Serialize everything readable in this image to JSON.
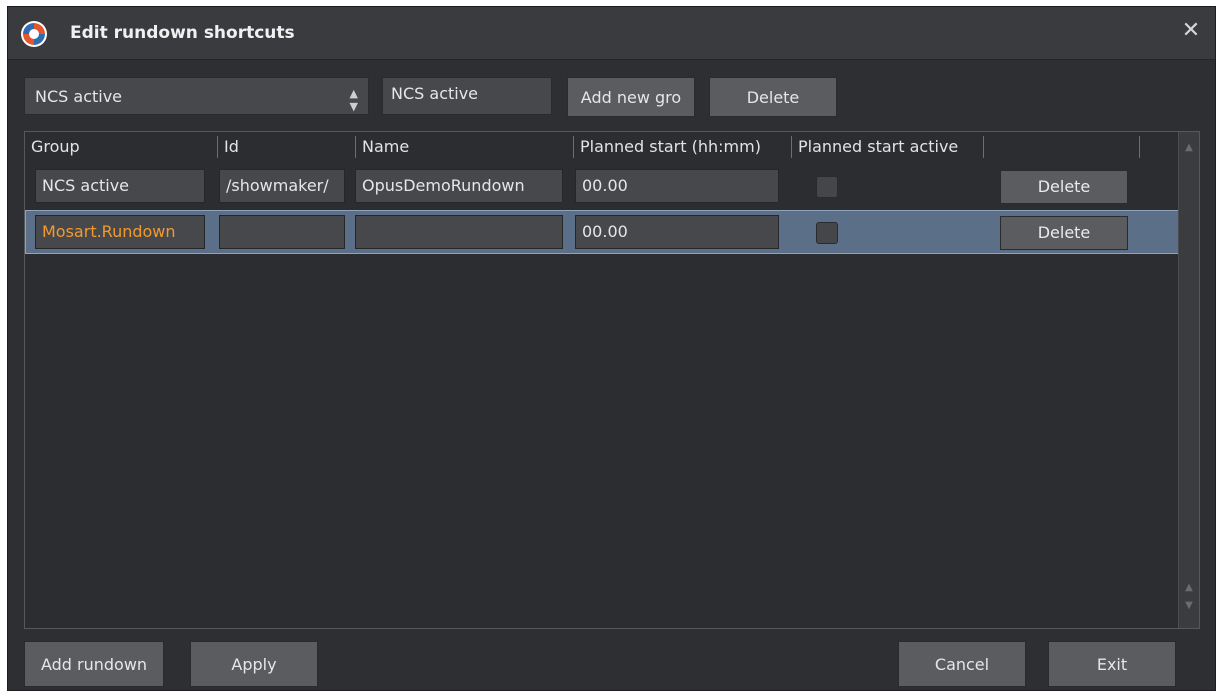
{
  "window": {
    "title": "Edit rundown shortcuts",
    "close_icon": "close-icon",
    "app_icon": "app-logo-icon"
  },
  "toolbar": {
    "group_select_value": "NCS active",
    "group_name_value": "NCS active",
    "add_group_label": "Add new gro",
    "delete_label": "Delete"
  },
  "table": {
    "columns": [
      "Group",
      "Id",
      "Name",
      "Planned start (hh:mm)",
      "Planned start active"
    ],
    "rows": [
      {
        "group": "NCS active",
        "id": "/showmaker/",
        "name": "OpusDemoRundown",
        "planned_start": "00.00",
        "active": false,
        "delete_label": "Delete",
        "selected": false
      },
      {
        "group": "Mosart.Rundown",
        "id": "",
        "name": "",
        "planned_start": "00.00",
        "active": false,
        "delete_label": "Delete",
        "selected": true
      }
    ]
  },
  "footer": {
    "add_rundown_label": "Add rundown",
    "apply_label": "Apply",
    "cancel_label": "Cancel",
    "exit_label": "Exit"
  },
  "colors": {
    "background": "#2d2f33",
    "selected_row": "#5c6f88",
    "accent_text": "#f39a2b"
  }
}
